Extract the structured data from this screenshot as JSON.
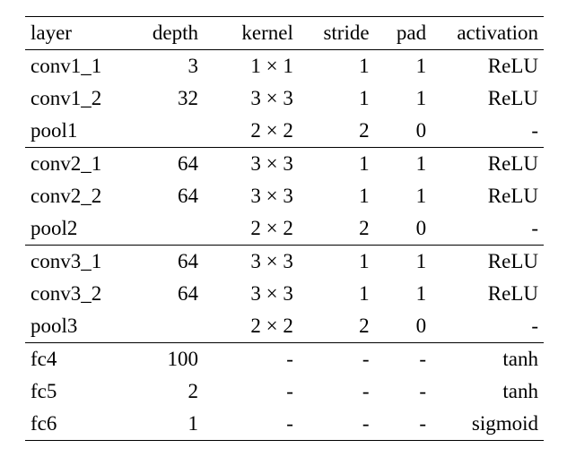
{
  "chart_data": {
    "type": "table",
    "columns": [
      "layer",
      "depth",
      "kernel",
      "stride",
      "pad",
      "activation"
    ],
    "groups": [
      [
        {
          "layer": "conv1_1",
          "depth": "3",
          "kernel": "1 × 1",
          "stride": "1",
          "pad": "1",
          "activation": "ReLU"
        },
        {
          "layer": "conv1_2",
          "depth": "32",
          "kernel": "3 × 3",
          "stride": "1",
          "pad": "1",
          "activation": "ReLU"
        },
        {
          "layer": "pool1",
          "depth": "",
          "kernel": "2 × 2",
          "stride": "2",
          "pad": "0",
          "activation": "-"
        }
      ],
      [
        {
          "layer": "conv2_1",
          "depth": "64",
          "kernel": "3 × 3",
          "stride": "1",
          "pad": "1",
          "activation": "ReLU"
        },
        {
          "layer": "conv2_2",
          "depth": "64",
          "kernel": "3 × 3",
          "stride": "1",
          "pad": "1",
          "activation": "ReLU"
        },
        {
          "layer": "pool2",
          "depth": "",
          "kernel": "2 × 2",
          "stride": "2",
          "pad": "0",
          "activation": "-"
        }
      ],
      [
        {
          "layer": "conv3_1",
          "depth": "64",
          "kernel": "3 × 3",
          "stride": "1",
          "pad": "1",
          "activation": "ReLU"
        },
        {
          "layer": "conv3_2",
          "depth": "64",
          "kernel": "3 × 3",
          "stride": "1",
          "pad": "1",
          "activation": "ReLU"
        },
        {
          "layer": "pool3",
          "depth": "",
          "kernel": "2 × 2",
          "stride": "2",
          "pad": "0",
          "activation": "-"
        }
      ],
      [
        {
          "layer": "fc4",
          "depth": "100",
          "kernel": "-",
          "stride": "-",
          "pad": "-",
          "activation": "tanh"
        },
        {
          "layer": "fc5",
          "depth": "2",
          "kernel": "-",
          "stride": "-",
          "pad": "-",
          "activation": "tanh"
        },
        {
          "layer": "fc6",
          "depth": "1",
          "kernel": "-",
          "stride": "-",
          "pad": "-",
          "activation": "sigmoid"
        }
      ]
    ]
  }
}
